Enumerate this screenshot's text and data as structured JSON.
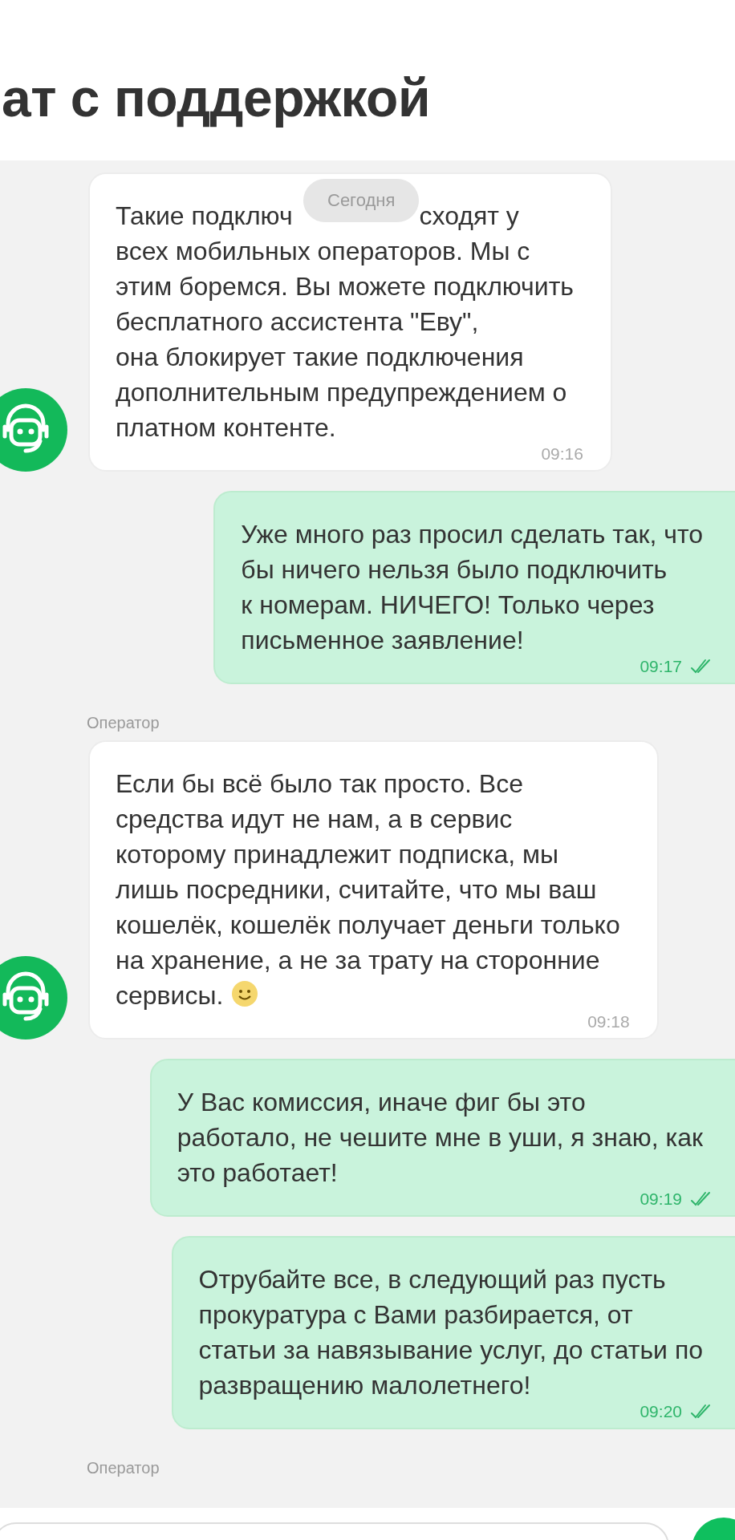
{
  "header": {
    "title": "ат с поддержкой"
  },
  "date_chip": "Сегодня",
  "messages": [
    {
      "kind": "incoming",
      "avatar": true,
      "covered_first_line": [
        "Такие подключ",
        "сходят у"
      ],
      "lines": [
        "всех мобильных операторов. Мы с",
        "этим боремся. Вы можете подключить",
        "бесплатного ассистента \"Еву\",",
        "она блокирует такие подключения",
        "дополнительным предупреждением о",
        "платном контенте."
      ],
      "time": "09:16"
    },
    {
      "kind": "outgoing",
      "lines": [
        "Уже много раз просил сделать так, что",
        "бы ничего нельзя было подключить",
        "к номерам. НИЧЕГО! Только через",
        "письменное заявление!"
      ],
      "time": "09:17",
      "read": true
    },
    {
      "kind": "label",
      "text": "Оператор"
    },
    {
      "kind": "incoming",
      "avatar": true,
      "lines": [
        "Если бы всё было так просто. Все",
        "средства идут не нам, а в сервис",
        "которому принадлежит подписка, мы",
        "лишь посредники, считайте, что мы ваш",
        "кошелёк, кошелёк получает деньги только",
        "на хранение, а не за трату на сторонние",
        "сервисы."
      ],
      "smiley": true,
      "time": "09:18"
    },
    {
      "kind": "outgoing",
      "lines": [
        "У Вас комиссия, иначе фиг бы это",
        "работало, не чешите мне в уши, я знаю, как",
        "это работает!"
      ],
      "time": "09:19",
      "read": true
    },
    {
      "kind": "outgoing",
      "lines": [
        "Отрубайте все, в следующий раз пусть",
        "прокуратура с Вами разбирается, от",
        "статьи за навязывание услуг, до статьи по",
        "развращению малолетнего!"
      ],
      "time": "09:20",
      "read": true
    },
    {
      "kind": "label",
      "text": "Оператор"
    }
  ]
}
